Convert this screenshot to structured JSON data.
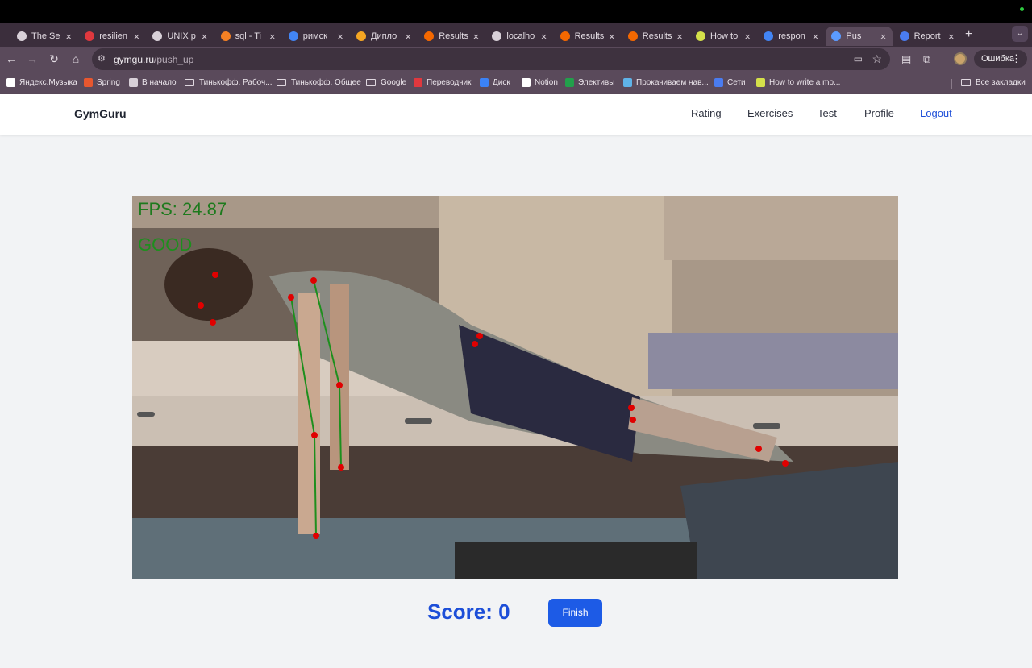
{
  "browser": {
    "tabs": [
      {
        "label": "The Se",
        "icon": "openai-icon",
        "color": "#d8d0d8"
      },
      {
        "label": "resilien",
        "icon": "angular-icon",
        "color": "#e0383e"
      },
      {
        "label": "UNIX p",
        "icon": "github-icon",
        "color": "#d8d0d8"
      },
      {
        "label": "sql - Ti",
        "icon": "stackoverflow-icon",
        "color": "#f48024"
      },
      {
        "label": "римск",
        "icon": "google-icon",
        "color": "#4285f4"
      },
      {
        "label": "Дипло",
        "icon": "app-icon",
        "color": "#f5a623"
      },
      {
        "label": "Results",
        "icon": "grafana-icon",
        "color": "#f46800"
      },
      {
        "label": "localho",
        "icon": "globe-icon",
        "color": "#d8d0d8"
      },
      {
        "label": "Results",
        "icon": "grafana-icon",
        "color": "#f46800"
      },
      {
        "label": "Results",
        "icon": "grafana-icon",
        "color": "#f46800"
      },
      {
        "label": "How to",
        "icon": "bookmark-icon",
        "color": "#d4e04a"
      },
      {
        "label": "respon",
        "icon": "google-icon",
        "color": "#4285f4"
      },
      {
        "label": "Pus",
        "icon": "app-icon",
        "color": "#5b9bff",
        "active": true
      },
      {
        "label": "Report",
        "icon": "docs-icon",
        "color": "#4a7cf0"
      }
    ],
    "url_host": "gymgu.ru",
    "url_path": "/push_up",
    "error_label": "Ошибка",
    "bookmarks": [
      {
        "label": "Яндекс.Музыка",
        "type": "icon",
        "color": "#ffffff"
      },
      {
        "label": "Spring",
        "type": "icon",
        "color": "#e8572f"
      },
      {
        "label": "В начало",
        "type": "icon",
        "color": "#d8d0d8"
      },
      {
        "label": "Тинькофф. Рабоч...",
        "type": "folder"
      },
      {
        "label": "Тинькофф. Общее",
        "type": "folder"
      },
      {
        "label": "Google",
        "type": "folder"
      },
      {
        "label": "Переводчик",
        "type": "icon",
        "color": "#e0383e"
      },
      {
        "label": "Диск",
        "type": "icon",
        "color": "#3b82f6"
      },
      {
        "label": "Notion",
        "type": "icon",
        "color": "#ffffff"
      },
      {
        "label": "Элективы",
        "type": "icon",
        "color": "#22a04b"
      },
      {
        "label": "Прокачиваем нав...",
        "type": "icon",
        "color": "#5fb3e8"
      },
      {
        "label": "Сети",
        "type": "icon",
        "color": "#4a7cf0"
      },
      {
        "label": "How to write a mo...",
        "type": "icon",
        "color": "#d4e04a"
      }
    ],
    "all_bookmarks": "Все закладки"
  },
  "app": {
    "brand": "GymGuru",
    "nav": [
      "Rating",
      "Exercises",
      "Test",
      "Profile",
      "Logout"
    ]
  },
  "video": {
    "fps_text": "FPS: 24.87",
    "status_text": "GOOD"
  },
  "footer": {
    "score_text": "Score: 0",
    "finish_label": "Finish"
  },
  "colors": {
    "accent": "#1d4ed8",
    "overlay_green": "#1d8f1d",
    "keypoint": "#e00000"
  }
}
